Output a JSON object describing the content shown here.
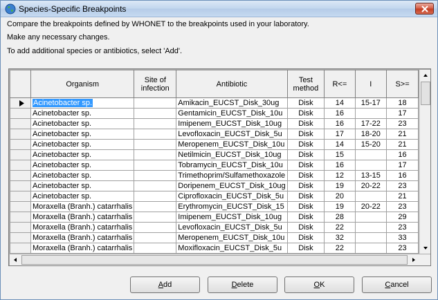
{
  "window": {
    "title": "Species-Specific Breakpoints",
    "icon": "globe-icon",
    "close_icon": "close-icon"
  },
  "instructions": [
    "Compare the breakpoints defined by WHONET to the breakpoints used in your laboratory.",
    "Make any necessary changes.",
    "To add additional species or antibiotics, select 'Add'."
  ],
  "grid": {
    "columns": [
      "",
      "Organism",
      "Site of infection",
      "Antibiotic",
      "Test method",
      "R<=",
      "I",
      "S>="
    ],
    "rows": [
      {
        "organism": "Acinetobacter sp.",
        "site": "",
        "antibiotic": "Amikacin_EUCST_Disk_30ug",
        "method": "Disk",
        "r": "14",
        "i": "15-17",
        "s": "18"
      },
      {
        "organism": "Acinetobacter sp.",
        "site": "",
        "antibiotic": "Gentamicin_EUCST_Disk_10u",
        "method": "Disk",
        "r": "16",
        "i": "",
        "s": "17"
      },
      {
        "organism": "Acinetobacter sp.",
        "site": "",
        "antibiotic": "Imipenem_EUCST_Disk_10ug",
        "method": "Disk",
        "r": "16",
        "i": "17-22",
        "s": "23"
      },
      {
        "organism": "Acinetobacter sp.",
        "site": "",
        "antibiotic": "Levofloxacin_EUCST_Disk_5u",
        "method": "Disk",
        "r": "17",
        "i": "18-20",
        "s": "21"
      },
      {
        "organism": "Acinetobacter sp.",
        "site": "",
        "antibiotic": "Meropenem_EUCST_Disk_10u",
        "method": "Disk",
        "r": "14",
        "i": "15-20",
        "s": "21"
      },
      {
        "organism": "Acinetobacter sp.",
        "site": "",
        "antibiotic": "Netilmicin_EUCST_Disk_10ug",
        "method": "Disk",
        "r": "15",
        "i": "",
        "s": "16"
      },
      {
        "organism": "Acinetobacter sp.",
        "site": "",
        "antibiotic": "Tobramycin_EUCST_Disk_10u",
        "method": "Disk",
        "r": "16",
        "i": "",
        "s": "17"
      },
      {
        "organism": "Acinetobacter sp.",
        "site": "",
        "antibiotic": "Trimethoprim/Sulfamethoxazole",
        "method": "Disk",
        "r": "12",
        "i": "13-15",
        "s": "16"
      },
      {
        "organism": "Acinetobacter sp.",
        "site": "",
        "antibiotic": "Doripenem_EUCST_Disk_10ug",
        "method": "Disk",
        "r": "19",
        "i": "20-22",
        "s": "23"
      },
      {
        "organism": "Acinetobacter sp.",
        "site": "",
        "antibiotic": "Ciprofloxacin_EUCST_Disk_5u",
        "method": "Disk",
        "r": "20",
        "i": "",
        "s": "21"
      },
      {
        "organism": "Moraxella (Branh.) catarrhalis",
        "site": "",
        "antibiotic": "Erythromycin_EUCST_Disk_15",
        "method": "Disk",
        "r": "19",
        "i": "20-22",
        "s": "23"
      },
      {
        "organism": "Moraxella (Branh.) catarrhalis",
        "site": "",
        "antibiotic": "Imipenem_EUCST_Disk_10ug",
        "method": "Disk",
        "r": "28",
        "i": "",
        "s": "29"
      },
      {
        "organism": "Moraxella (Branh.) catarrhalis",
        "site": "",
        "antibiotic": "Levofloxacin_EUCST_Disk_5u",
        "method": "Disk",
        "r": "22",
        "i": "",
        "s": "23"
      },
      {
        "organism": "Moraxella (Branh.) catarrhalis",
        "site": "",
        "antibiotic": "Meropenem_EUCST_Disk_10u",
        "method": "Disk",
        "r": "32",
        "i": "",
        "s": "33"
      },
      {
        "organism": "Moraxella (Branh.) catarrhalis",
        "site": "",
        "antibiotic": "Moxifloxacin_EUCST_Disk_5u",
        "method": "Disk",
        "r": "22",
        "i": "",
        "s": "23"
      }
    ]
  },
  "buttons": {
    "add": {
      "mnemonic": "A",
      "rest": "dd"
    },
    "delete": {
      "mnemonic": "D",
      "rest": "elete"
    },
    "ok": {
      "mnemonic": "O",
      "rest": "K"
    },
    "cancel": {
      "mnemonic": "C",
      "rest": "ancel"
    }
  }
}
